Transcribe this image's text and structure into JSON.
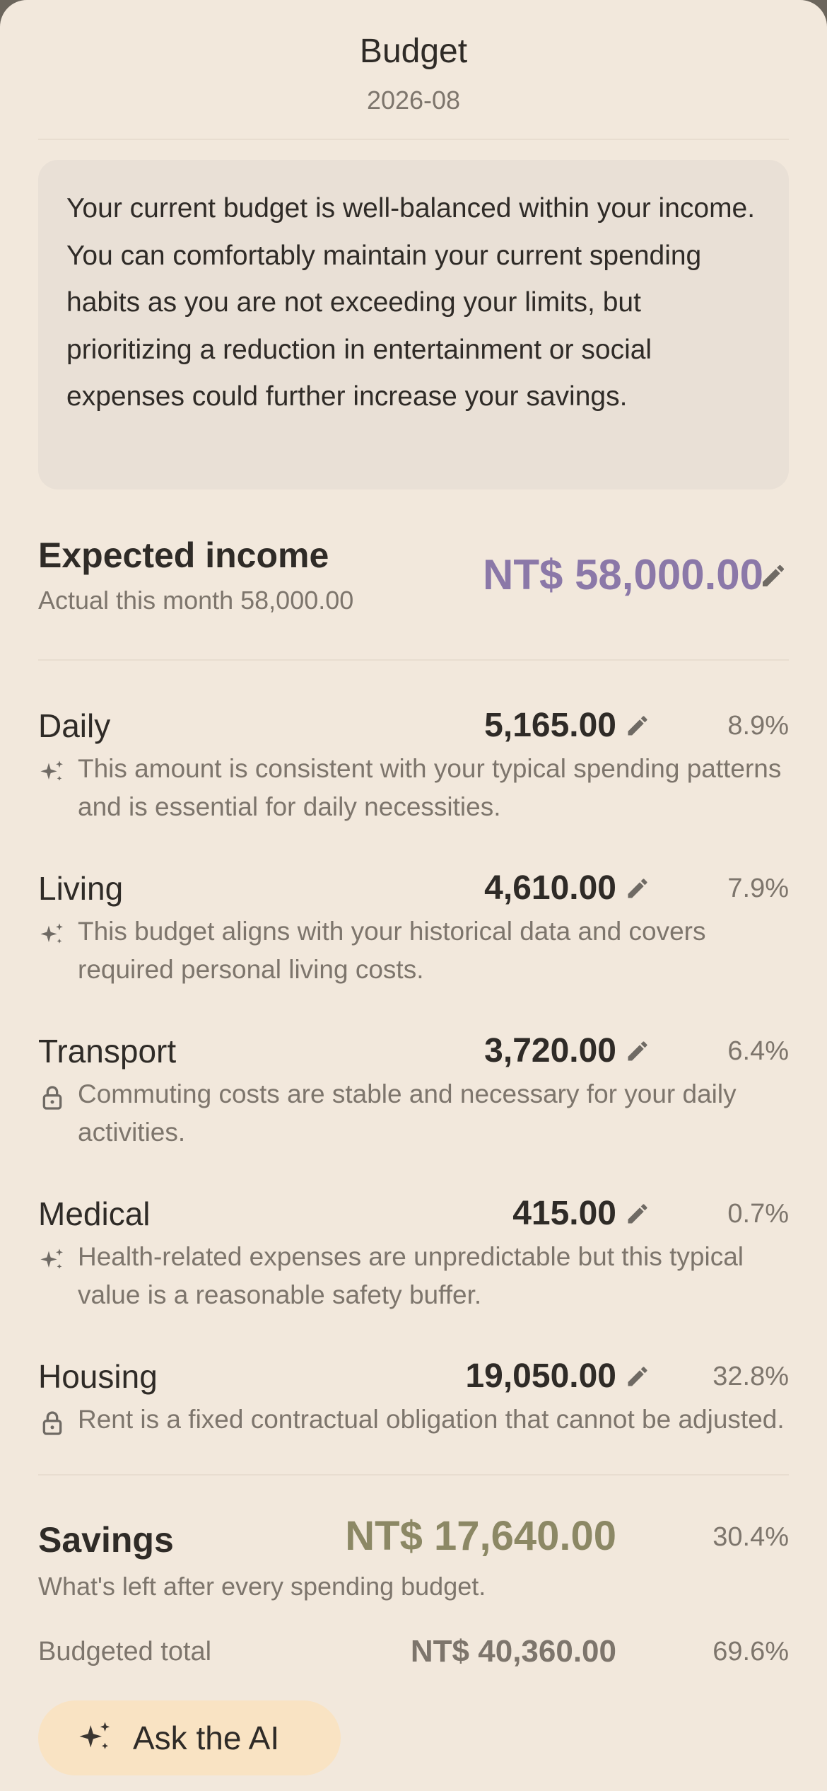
{
  "header": {
    "title": "Budget",
    "month": "2026-08"
  },
  "summary": "Your current budget is well-balanced within your income. You can comfortably maintain your current spending habits as you are not exceeding your limits, but prioritizing a reduction in entertainment or social expenses could further increase your savings.",
  "income": {
    "label": "Expected income",
    "actual": "Actual this month 58,000.00",
    "amount": "NT$ 58,000.00"
  },
  "categories": [
    {
      "name": "Daily",
      "amount": "5,165.00",
      "percent": "8.9%",
      "icon": "sparkle-icon",
      "note": "This amount is consistent with your typical spending patterns and is essential for daily necessities."
    },
    {
      "name": "Living",
      "amount": "4,610.00",
      "percent": "7.9%",
      "icon": "sparkle-icon",
      "note": "This budget aligns with your historical data and covers required personal living costs."
    },
    {
      "name": "Transport",
      "amount": "3,720.00",
      "percent": "6.4%",
      "icon": "lock-icon",
      "note": "Commuting costs are stable and necessary for your daily activities."
    },
    {
      "name": "Medical",
      "amount": "415.00",
      "percent": "0.7%",
      "icon": "sparkle-icon",
      "note": "Health-related expenses are unpredictable but this typical value is a reasonable safety buffer."
    },
    {
      "name": "Housing",
      "amount": "19,050.00",
      "percent": "32.8%",
      "icon": "lock-icon",
      "note": "Rent is a fixed contractual obligation that cannot be adjusted."
    }
  ],
  "savings": {
    "label": "Savings",
    "amount": "NT$ 17,640.00",
    "percent": "30.4%",
    "description": "What's left after every spending budget."
  },
  "total": {
    "label": "Budgeted total",
    "amount": "NT$ 40,360.00",
    "percent": "69.6%"
  },
  "ask_ai": {
    "label": "Ask the AI"
  },
  "colors": {
    "background": "#f2e8dc",
    "income_accent": "#8b78a8",
    "savings_accent": "#8c8865",
    "button": "#f9e3c3"
  }
}
